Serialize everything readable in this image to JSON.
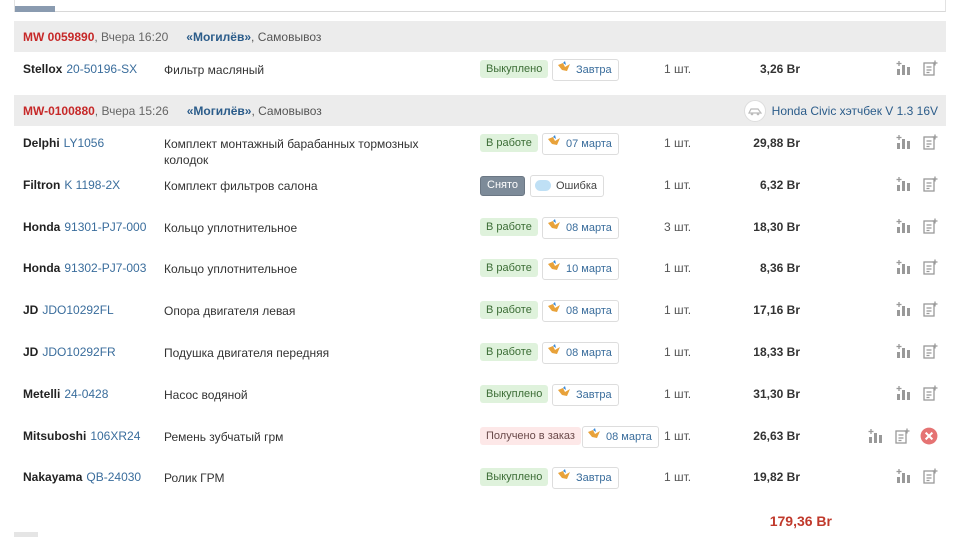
{
  "colors": {
    "accent_red": "#c62828",
    "link_blue": "#3a6d9c",
    "status_green": "#dff2dc",
    "status_gray": "#7d8b99",
    "status_pink": "#fde8e8"
  },
  "orders": [
    {
      "id": "MW 0059890",
      "date": ", Вчера 16:20",
      "city": "«Могилёв»",
      "pickup": ", Самовывоз",
      "car": "",
      "items": [
        {
          "brand": "Stellox",
          "article": "20-50196-SX",
          "desc": "Фильтр масляный",
          "status": "Выкуплено",
          "status_type": "green",
          "date": "Завтра",
          "date_icon": "bird-icon",
          "qty": "1 шт.",
          "price": "3,26 Br"
        }
      ]
    },
    {
      "id": "MW-0100880",
      "date": ", Вчера 15:26",
      "city": "«Могилёв»",
      "pickup": ", Самовывоз",
      "car": "Honda Civic хэтчбек V 1.3 16V",
      "items": [
        {
          "brand": "Delphi",
          "article": "LY1056",
          "desc": "Комплект монтажный барабанных тормозных колодок",
          "status": "В работе",
          "status_type": "green",
          "date": "07 марта",
          "date_icon": "bird-icon",
          "qty": "1 шт.",
          "price": "29,88 Br"
        },
        {
          "brand": "Filtron",
          "article": "K 1198-2X",
          "desc": "Комплект фильтров салона",
          "status": "Снято",
          "status_type": "gray",
          "date": "Ошибка",
          "date_icon": "cloud-icon",
          "qty": "1 шт.",
          "price": "6,32 Br"
        },
        {
          "brand": "Honda",
          "article": "91301-PJ7-000",
          "desc": "Кольцо уплотнительное",
          "status": "В работе",
          "status_type": "green",
          "date": "08 марта",
          "date_icon": "bird-icon",
          "qty": "3 шт.",
          "price": "18,30 Br"
        },
        {
          "brand": "Honda",
          "article": "91302-PJ7-003",
          "desc": "Кольцо уплотнительное",
          "status": "В работе",
          "status_type": "green",
          "date": "10 марта",
          "date_icon": "bird-icon",
          "qty": "1 шт.",
          "price": "8,36 Br"
        },
        {
          "brand": "JD",
          "article": "JDO10292FL",
          "desc": "Опора двигателя левая",
          "status": "В работе",
          "status_type": "green",
          "date": "08 марта",
          "date_icon": "bird-icon",
          "qty": "1 шт.",
          "price": "17,16 Br"
        },
        {
          "brand": "JD",
          "article": "JDO10292FR",
          "desc": "Подушка двигателя передняя",
          "status": "В работе",
          "status_type": "green",
          "date": "08 марта",
          "date_icon": "bird-icon",
          "qty": "1 шт.",
          "price": "18,33 Br"
        },
        {
          "brand": "Metelli",
          "article": "24-0428",
          "desc": "Насос водяной",
          "status": "Выкуплено",
          "status_type": "green",
          "date": "Завтра",
          "date_icon": "bird-icon",
          "qty": "1 шт.",
          "price": "31,30 Br"
        },
        {
          "brand": "Mitsuboshi",
          "article": "106XR24",
          "desc": "Ремень зубчатый грм",
          "status": "Получено в заказ",
          "status_type": "pink",
          "date": "08 марта",
          "date_icon": "bird-icon",
          "qty": "1 шт.",
          "price": "26,63 Br",
          "cancel": true
        },
        {
          "brand": "Nakayama",
          "article": "QB-24030",
          "desc": "Ролик ГРМ",
          "status": "Выкуплено",
          "status_type": "green",
          "date": "Завтра",
          "date_icon": "bird-icon",
          "qty": "1 шт.",
          "price": "19,82 Br"
        }
      ]
    }
  ],
  "total": "179,36 Br"
}
